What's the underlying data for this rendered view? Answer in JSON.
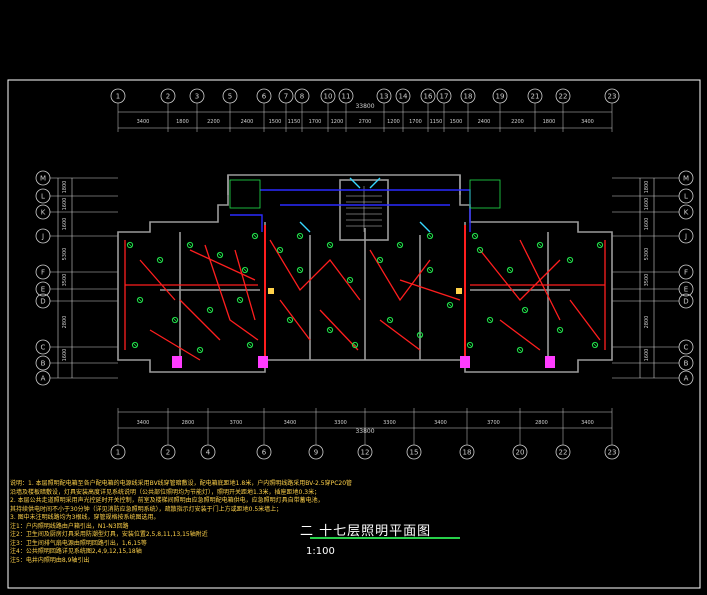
{
  "drawing": {
    "title": "二 十七层照明平面图",
    "scale": "1:100",
    "total_dim_top": "33800",
    "total_dim_bottom": "33800",
    "colors": {
      "background": "#000000",
      "frame": "#ffffff",
      "wall": "#9a9a9a",
      "dim": "#cfcfcf",
      "wiring_red": "#ff1e1e",
      "wiring_blue": "#2a2aff",
      "fixture_green": "#21e04a",
      "notes_yellow": "#ffd24a",
      "magenta": "#ff3cff",
      "cyan": "#38d8ff"
    }
  },
  "top_axes": [
    "1",
    "2",
    "3",
    "5",
    "6",
    "7",
    "8",
    "10",
    "11",
    "13",
    "14",
    "16",
    "17",
    "18",
    "19",
    "21",
    "22",
    "23"
  ],
  "top_dims": [
    "3400",
    "1800",
    "2200",
    "2400",
    "1500",
    "1150",
    "1700",
    "1200",
    "2700",
    "1200",
    "1700",
    "1150",
    "1500",
    "2400",
    "2200",
    "1800",
    "3400"
  ],
  "bottom_axes": [
    "1",
    "2",
    "4",
    "6",
    "9",
    "12",
    "15",
    "18",
    "20",
    "22",
    "23"
  ],
  "bottom_dims": [
    "3400",
    "2800",
    "3700",
    "3400",
    "3300",
    "3300",
    "3400",
    "3700",
    "2800",
    "3400"
  ],
  "left_axes": [
    "M",
    "L",
    "K",
    "J",
    "F",
    "E",
    "D",
    "C",
    "B",
    "A"
  ],
  "right_axes": [
    "M",
    "L",
    "K",
    "J",
    "F",
    "E",
    "D",
    "C",
    "B",
    "A"
  ],
  "side_dims": [
    "1800",
    "1600",
    "1600",
    "5300",
    "3500",
    "2800",
    "1600"
  ],
  "notes": [
    "说明：1. 本层照明配电箱至各户配电箱的电源线采用BV线穿管暗敷设，配电箱底距地1.8米，户内照明线路采用BV-2.5穿PC20管",
    "   沿墙及楼板暗敷设，灯具安装高度详见系统说明（公共部位照明均为节能灯），照明开关距地1.3米，插座距地0.3米；",
    "2. 本层公共走道照明采用声光控延时开关控制，前室及楼梯间照明由应急照明配电箱供电，应急照明灯具自带蓄电池，",
    "   其持续供电时间不小于30分钟（详见消防应急照明系统），疏散指示灯安装于门上方或距地0.5米墙上；",
    "3. 图中未注明线路均为3根线，穿管规格按系统图选用。",
    "   注1：户内照明线路由户箱引出，N1-N3回路",
    "   注2：卫生间及厨房灯具采用防潮型灯具，安装位置2,5,8,11,13,15轴附近",
    "   注3：卫生间排气扇电源由照明回路引出，1,6,15等",
    "   注4：公共照明回路详见系统图2,4,9,12,15,18轴",
    "   注5：电井内照明由8,9轴引出"
  ]
}
